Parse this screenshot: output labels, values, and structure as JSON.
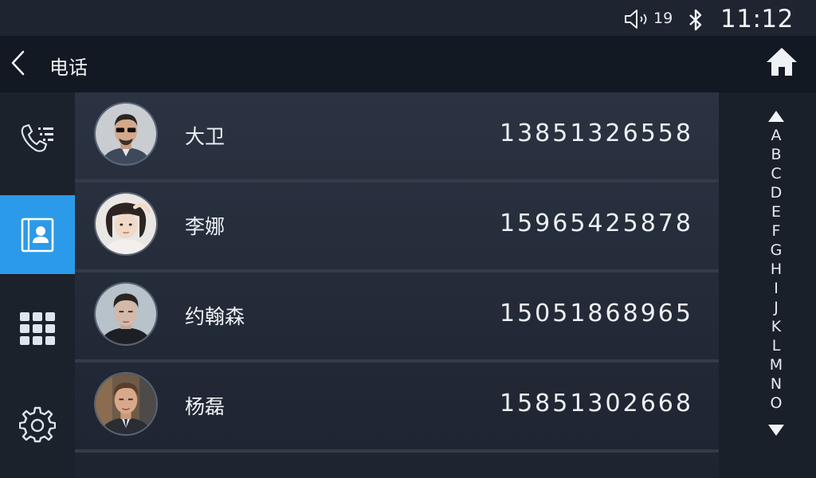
{
  "status": {
    "volume_value": "19",
    "time": "11:12"
  },
  "header": {
    "title": "电话",
    "back_icon": "chevron-left-icon",
    "home_icon": "home-icon"
  },
  "sidebar": {
    "items": [
      {
        "id": "call-log",
        "icon": "call-log-icon",
        "active": false
      },
      {
        "id": "contacts",
        "icon": "contacts-icon",
        "active": true
      },
      {
        "id": "dialpad",
        "icon": "dialpad-icon",
        "active": false
      },
      {
        "id": "settings",
        "icon": "gear-icon",
        "active": false
      }
    ]
  },
  "contacts": [
    {
      "name": "大卫",
      "phone": "13851326558"
    },
    {
      "name": "李娜",
      "phone": "15965425878"
    },
    {
      "name": "约翰森",
      "phone": "15051868965"
    },
    {
      "name": "杨磊",
      "phone": "15851302668"
    }
  ],
  "index": {
    "letters": [
      "A",
      "B",
      "C",
      "D",
      "E",
      "F",
      "G",
      "H",
      "I",
      "J",
      "K",
      "L",
      "M",
      "N",
      "O"
    ],
    "up_icon": "triangle-up-icon",
    "down_icon": "triangle-down-icon"
  },
  "colors": {
    "accent": "#2b9ae9",
    "background": "#161c24",
    "text": "#eef1f5"
  }
}
